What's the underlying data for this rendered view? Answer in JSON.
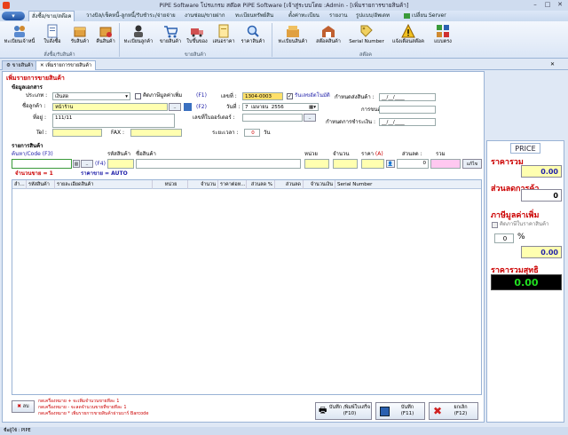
{
  "window": {
    "title": "PiPE Software โปรแกรม สต๊อค PiPE Software [เจ้าสู่ระบบโดย :Admin - [เพิ่มรายการขายสินค้า]"
  },
  "menu": {
    "orb": "▾",
    "tabs": [
      "สั่งซื้อ/ขาย/สต๊อค",
      "วางบิล/เช็คหนี้-ลูกหนี้/รับชำระ/จ่ายจ่าย",
      "งานซ่อม/ขายฝาก",
      "ทะเบียนทรัพย์สิน",
      "ตั้งค่าทะเบียน",
      "รายงาน",
      "รูปแบบ/อัพเดท",
      "เปลี่ยน Server"
    ]
  },
  "ribbon": {
    "buttons": [
      "ทะเบียนเจ้าหนี้",
      "ใบสั่งซื้อ",
      "รับสินค้า",
      "คืนสินค้า",
      "ทะเบียนลูกค้า",
      "ขายสินค้า",
      "ใบขึ้นของ",
      "เสนอราคา",
      "ราคาสินค้า",
      "ทะเบียนสินค้า",
      "สต๊อคสินค้า",
      "Serial Number",
      "แจ้งเตือนสต๊อค",
      "แบบตรง"
    ],
    "groups": [
      "สั่งซื้อ/รับสินค้า",
      "ขายสินค้า",
      "สต๊อค"
    ]
  },
  "tabs": {
    "t1": "ขายสินค้า",
    "t2": "เพิ่มรายการขายสินค้า"
  },
  "form": {
    "page_title": "เพิ่มรายการขายสินค้า",
    "section_customer": "ข้อมูลเอกสาร",
    "type_label": "ประเภท :",
    "type_value": "เงินสด",
    "vat_check": "คิดภาษีมูลค่าเพิ่ม",
    "f1": "(F1)",
    "customer_label": "ชื่อลูกค้า :",
    "customer_value": "หน้าร้าน",
    "f2": "(F2)",
    "address_label": "ที่อยู่ :",
    "address_value": "111/11",
    "tel_label": "Tel :",
    "fax_label": "FAX :",
    "docno_label": "เลขที่ :",
    "docno_value": "1304-0003",
    "auto_check": "รันเลขอัตโนมัติ",
    "date_label": "วันที่ :",
    "date_day": "7",
    "date_month": "เมษายน",
    "date_year": "2556",
    "po_label": "เลขที่ใบออร์เดอร์ :",
    "period_label": "ระยะเวลา :",
    "period_value": "0",
    "period_unit": "วัน",
    "ship_label": "กำหนดส่งสินค้า :",
    "ship_value": "__/__/____",
    "shipby_label": "การขนส่ง :",
    "pay_label": "กำหนดการชำระเงิน :",
    "pay_value": "__/__/____"
  },
  "items": {
    "section": "รายการสินค้า",
    "search_label": "ค้นหา/Code (F3)",
    "f4": "(F4)",
    "code_label": "รหัสสินค้า",
    "name_label": "ชื่อสินค้า",
    "unit_label": "หน่วย",
    "qty_label": "จำนวน",
    "price_label": "ราคา",
    "price_a": "(A)",
    "disc_label": "ส่วนลด :",
    "disc_value": "0",
    "total_label": "รวม",
    "edit_btn": "แก้ไข",
    "count_label": "จำนวนขาย = 1",
    "price_mode": "ราคาขาย = AUTO",
    "columns": [
      "ลำ...",
      "รหัสสินค้า",
      "รายละเอียดสินค้า",
      "หน่วย",
      "จำนวน",
      "ราคาต่อห...",
      "ส่วนลด %",
      "ส่วนลด",
      "จำนวนเงิน",
      "Serial Number"
    ]
  },
  "footer": {
    "delete_btn": "ลบ",
    "hints": [
      "กดเครื่องหมาย + จะเพิ่มจำนวนขายทีละ 1",
      "กดเครื่องหมาย - จะลดจำนวนขายที่ขายทีละ 1",
      "กดเครื่องหมาย * เพิ่มรายการขายสินค้าผ่านบาร์ Barcode"
    ],
    "save_print": "บันทึก /พิมพ์ใบเสร็จ",
    "save_print_key": "(F10)",
    "save": "บันทึก",
    "save_key": "(F11)",
    "cancel": "ยกเลิก",
    "cancel_key": "(F12)"
  },
  "price": {
    "header": "PRICE",
    "subtotal_label": "ราคารวม",
    "subtotal_value": "0.00",
    "discount_label": "ส่วนลดการค้า",
    "discount_value": "0",
    "vat_label": "ภาษีมูลค่าเพิ่ม",
    "vat_check": "คิดภาษีในราคาสินค้า",
    "vat_rate": "0",
    "vat_pct": "%",
    "vat_value": "0.00",
    "net_label": "ราคารวมสุทธิ",
    "net_value": "0.00"
  },
  "status": {
    "text": "ชื่อผู้ใช้ : PIPE"
  }
}
